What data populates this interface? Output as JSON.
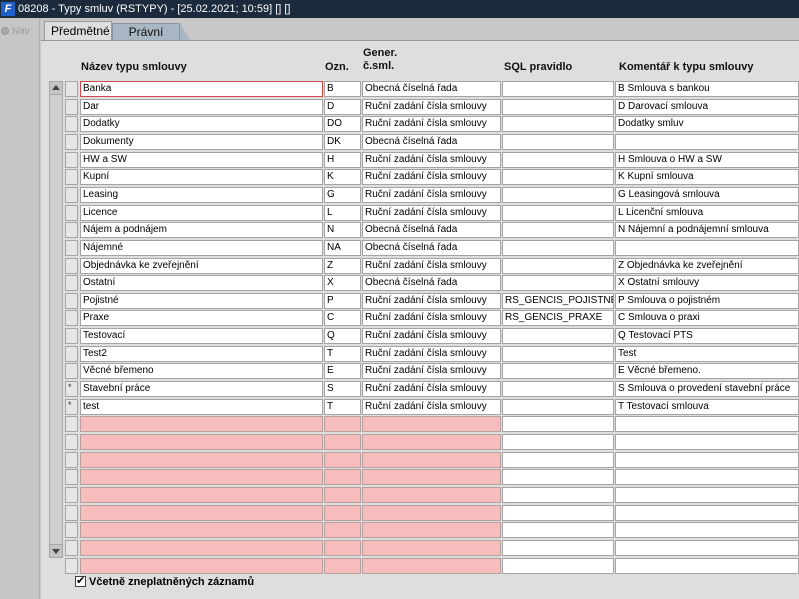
{
  "window": {
    "title": "08208 - Typy smluv (RSTYPY) - [25.02.2021; 10:59]  [] []",
    "icon_label": "F"
  },
  "nav": {
    "label": "Nav",
    "icon": "radio-dot-icon"
  },
  "tabs": [
    {
      "label": "Předmětné",
      "active": true
    },
    {
      "label": "Právní",
      "active": false
    }
  ],
  "grid": {
    "columns": {
      "name": "Název typu smlouvy",
      "ozn": "Ozn.",
      "gen_line1": "Gener.",
      "gen_line2": "č.sml.",
      "sql": "SQL pravidlo",
      "kom": "Komentář k typu smlouvy"
    },
    "rows": [
      {
        "marker": "",
        "name": "Banka",
        "ozn": "B",
        "gen": "Obecná číselná řada",
        "sql": "",
        "kom": "B Smlouva s bankou"
      },
      {
        "marker": "",
        "name": "Dar",
        "ozn": "D",
        "gen": "Ruční zadání čísla smlouvy",
        "sql": "",
        "kom": "D Darovací smlouva"
      },
      {
        "marker": "",
        "name": "Dodatky",
        "ozn": "DO",
        "gen": "Ruční zadání čísla smlouvy",
        "sql": "",
        "kom": "Dodatky smluv"
      },
      {
        "marker": "",
        "name": "Dokumenty",
        "ozn": "DK",
        "gen": "Obecná číselná řada",
        "sql": "",
        "kom": ""
      },
      {
        "marker": "",
        "name": "HW a SW",
        "ozn": "H",
        "gen": "Ruční zadání čísla smlouvy",
        "sql": "",
        "kom": "H Smlouva o HW a SW"
      },
      {
        "marker": "",
        "name": "Kupní",
        "ozn": "K",
        "gen": "Ruční zadání čísla smlouvy",
        "sql": "",
        "kom": "K Kupní smlouva"
      },
      {
        "marker": "",
        "name": "Leasing",
        "ozn": "G",
        "gen": "Ruční zadání čísla smlouvy",
        "sql": "",
        "kom": "G Leasingová smlouva"
      },
      {
        "marker": "",
        "name": "Licence",
        "ozn": "L",
        "gen": "Ruční zadání čísla smlouvy",
        "sql": "",
        "kom": "L Licenční smlouva"
      },
      {
        "marker": "",
        "name": "Nájem a podnájem",
        "ozn": "N",
        "gen": "Obecná číselná řada",
        "sql": "",
        "kom": "N Nájemní a podnájemní smlouva"
      },
      {
        "marker": "",
        "name": "Nájemné",
        "ozn": "NA",
        "gen": "Obecná číselná řada",
        "sql": "",
        "kom": ""
      },
      {
        "marker": "",
        "name": "Objednávka ke zveřejnění",
        "ozn": "Z",
        "gen": "Ruční zadání čísla smlouvy",
        "sql": "",
        "kom": "Z Objednávka ke zveřejnění"
      },
      {
        "marker": "",
        "name": "Ostatní",
        "ozn": "X",
        "gen": "Obecná číselná řada",
        "sql": "",
        "kom": "X Ostatní smlouvy"
      },
      {
        "marker": "",
        "name": "Pojistné",
        "ozn": "P",
        "gen": "Ruční zadání čísla smlouvy",
        "sql": "RS_GENCIS_POJISTNE",
        "kom": "P Smlouva o pojistném"
      },
      {
        "marker": "",
        "name": "Praxe",
        "ozn": "C",
        "gen": "Ruční zadání čísla smlouvy",
        "sql": "RS_GENCIS_PRAXE",
        "kom": "C Smlouva o praxi"
      },
      {
        "marker": "",
        "name": "Testovací",
        "ozn": "Q",
        "gen": "Ruční zadání čísla smlouvy",
        "sql": "",
        "kom": "Q Testovací PTS"
      },
      {
        "marker": "",
        "name": "Test2",
        "ozn": "T",
        "gen": "Ruční zadání čísla smlouvy",
        "sql": "",
        "kom": "Test"
      },
      {
        "marker": "",
        "name": "Věcné břemeno",
        "ozn": "E",
        "gen": "Ruční zadání čísla smlouvy",
        "sql": "",
        "kom": "E Věcné břemeno."
      },
      {
        "marker": "*",
        "name": "Stavební práce",
        "ozn": "S",
        "gen": "Ruční zadání čísla smlouvy",
        "sql": "",
        "kom": "S Smlouva o provedení stavební práce"
      },
      {
        "marker": "*",
        "name": "test",
        "ozn": "T",
        "gen": "Ruční zadání čísla smlouvy",
        "sql": "",
        "kom": "T Testovací smlouva"
      }
    ],
    "empty_rows": 9
  },
  "footer": {
    "checkbox_label": "Včetně zneplatněných záznamů",
    "checkbox_checked": true,
    "check_glyph": "✔"
  }
}
